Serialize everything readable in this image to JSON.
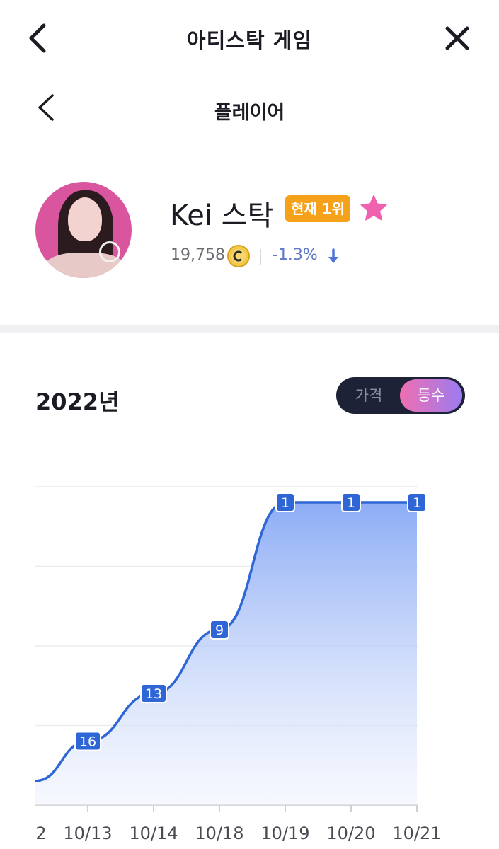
{
  "header": {
    "title": "아티스탁 게임"
  },
  "subheader": {
    "title": "플레이어"
  },
  "player": {
    "name": "Kei 스탁",
    "rank_badge": "현재 1위",
    "price": "19,758",
    "change": "-1.3%",
    "favorite": true
  },
  "colors": {
    "badge": "#f5a11a",
    "star": "#f062b0",
    "change": "#5f78c8",
    "line": "#2f66d6"
  },
  "icons": [
    "back-icon",
    "close-icon",
    "star-icon",
    "coin-icon",
    "down-arrow-icon"
  ],
  "year_label": "2022년",
  "toggle": {
    "options": [
      "가격",
      "등수"
    ],
    "selected": "등수"
  },
  "chart_data": {
    "type": "area",
    "categories": [
      "2",
      "10/13",
      "10/14",
      "10/18",
      "10/19",
      "10/20",
      "10/21"
    ],
    "series": [
      {
        "values": [
          18.5,
          16,
          13,
          9,
          1,
          1,
          1
        ],
        "labels": [
          "",
          "16",
          "13",
          "9",
          "1",
          "1",
          "1"
        ]
      }
    ],
    "y_inverted": true,
    "grid": true
  }
}
